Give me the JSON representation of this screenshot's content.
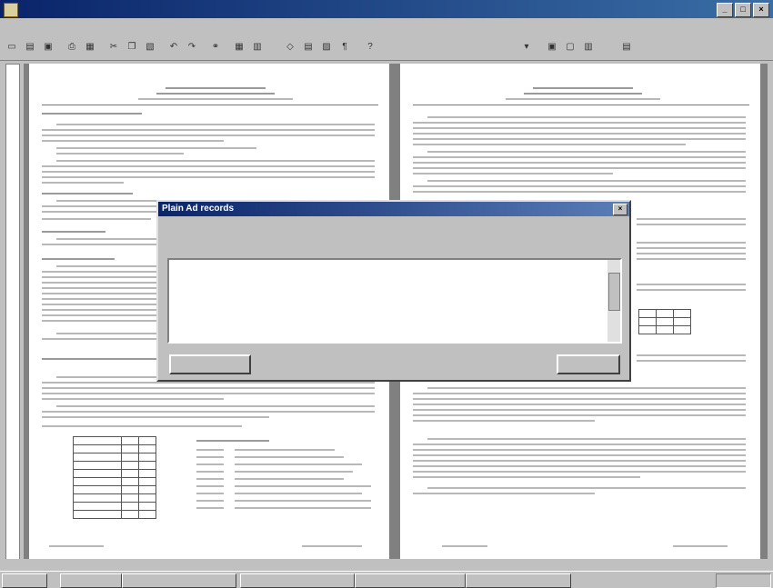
{
  "window": {
    "title": "",
    "controls": [
      "_",
      "□",
      "×"
    ]
  },
  "menu": [],
  "toolbar": {
    "zoom": ""
  },
  "dialog": {
    "title": "Plain Ad records",
    "filter_label": "",
    "filter_value": "",
    "columns": [
      "",
      "",
      "",
      "",
      ""
    ],
    "rows": [
      [
        "",
        "",
        "",
        "",
        ""
      ],
      [
        "",
        "",
        "",
        "",
        ""
      ],
      [
        "",
        "",
        "",
        "",
        ""
      ],
      [
        "",
        "",
        "",
        "",
        ""
      ],
      [
        "",
        "",
        "",
        "",
        ""
      ],
      [
        "",
        "",
        "",
        "",
        ""
      ],
      [
        "",
        "",
        "",
        "",
        ""
      ]
    ],
    "left_button": "",
    "right_button": ""
  },
  "statusbar": [],
  "taskbar": {
    "tasks": [
      "",
      "",
      "",
      "",
      "",
      ""
    ],
    "clock": ""
  }
}
